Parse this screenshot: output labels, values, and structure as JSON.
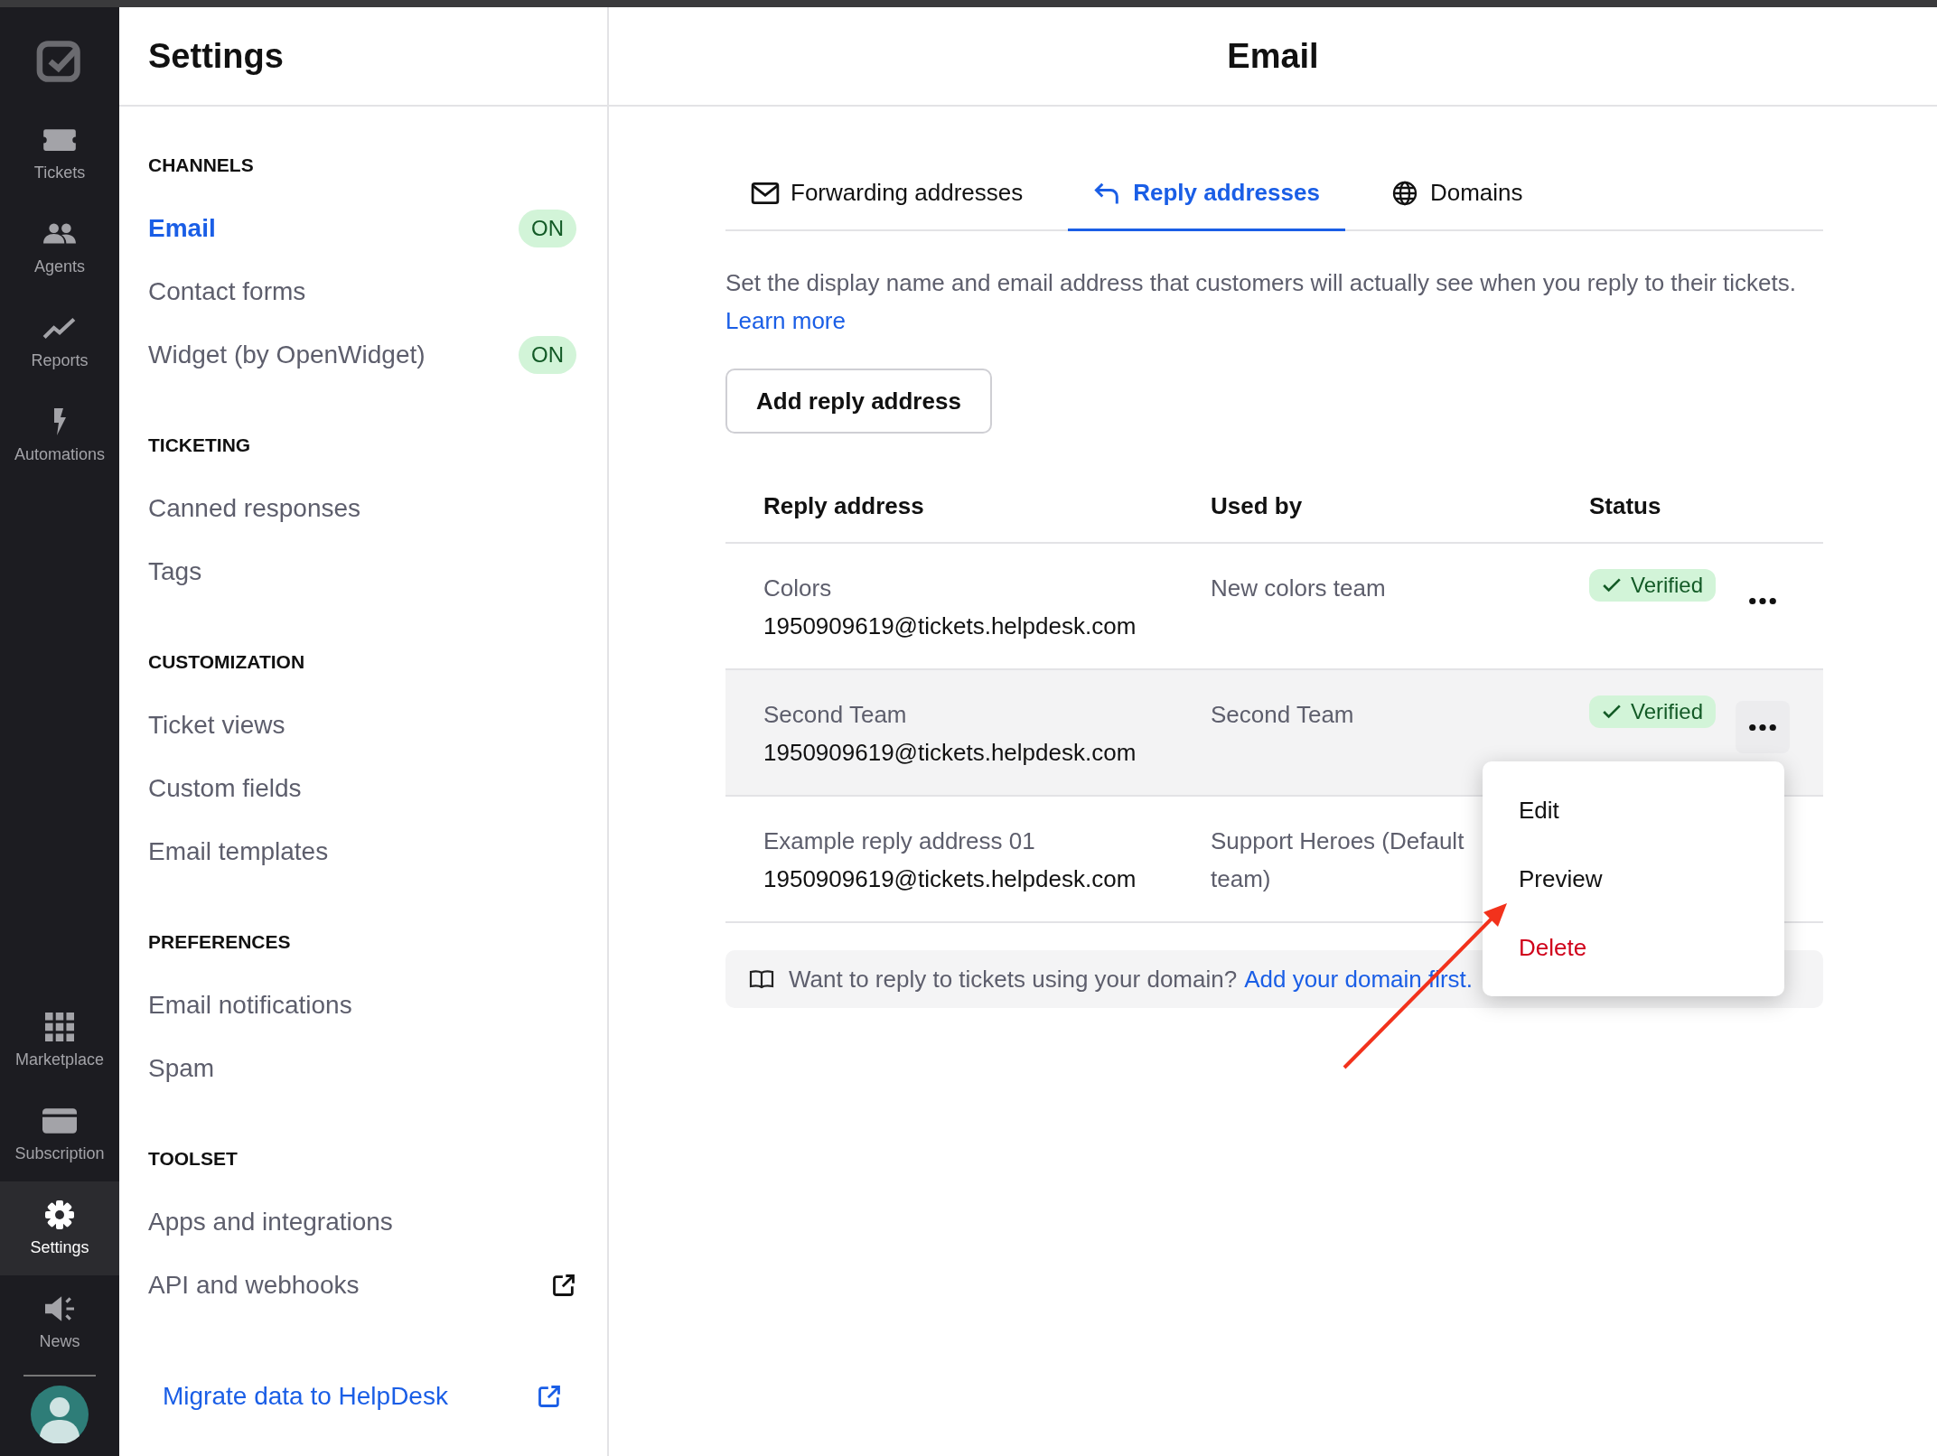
{
  "rail": {
    "top": [
      {
        "label": "Tickets",
        "selected": false
      },
      {
        "label": "Agents",
        "selected": false
      },
      {
        "label": "Reports",
        "selected": false
      },
      {
        "label": "Automations",
        "selected": false
      }
    ],
    "bottom": [
      {
        "label": "Marketplace",
        "selected": false
      },
      {
        "label": "Subscription",
        "selected": false
      },
      {
        "label": "Settings",
        "selected": true
      },
      {
        "label": "News",
        "selected": false
      }
    ]
  },
  "sidebar": {
    "title": "Settings",
    "sections": [
      {
        "heading": "CHANNELS",
        "items": [
          {
            "label": "Email",
            "selected": true,
            "badge": "ON"
          },
          {
            "label": "Contact forms",
            "selected": false
          },
          {
            "label": "Widget (by OpenWidget)",
            "selected": false,
            "badge": "ON"
          }
        ]
      },
      {
        "heading": "TICKETING",
        "items": [
          {
            "label": "Canned responses",
            "selected": false
          },
          {
            "label": "Tags",
            "selected": false
          }
        ]
      },
      {
        "heading": "CUSTOMIZATION",
        "items": [
          {
            "label": "Ticket views",
            "selected": false
          },
          {
            "label": "Custom fields",
            "selected": false
          },
          {
            "label": "Email templates",
            "selected": false
          }
        ]
      },
      {
        "heading": "PREFERENCES",
        "items": [
          {
            "label": "Email notifications",
            "selected": false
          },
          {
            "label": "Spam",
            "selected": false
          }
        ]
      },
      {
        "heading": "TOOLSET",
        "items": [
          {
            "label": "Apps and integrations",
            "selected": false
          },
          {
            "label": "API and webhooks",
            "selected": false,
            "external": true
          }
        ]
      }
    ],
    "migrate_link": "Migrate data to HelpDesk"
  },
  "main": {
    "title": "Email",
    "tabs": [
      {
        "label": "Forwarding addresses",
        "selected": false
      },
      {
        "label": "Reply addresses",
        "selected": true
      },
      {
        "label": "Domains",
        "selected": false
      }
    ],
    "description": "Set the display name and email address that customers will actually see when you reply to their tickets.",
    "learn_more": "Learn more",
    "add_button": "Add reply address",
    "table": {
      "columns": [
        "Reply address",
        "Used by",
        "Status"
      ],
      "rows": [
        {
          "name": "Colors",
          "email": "1950909619@tickets.helpdesk.com",
          "used_by": "New colors team",
          "status": "Verified",
          "hovered": false
        },
        {
          "name": "Second Team",
          "email": "1950909619@tickets.helpdesk.com",
          "used_by": "Second Team",
          "status": "Verified",
          "hovered": true
        },
        {
          "name": "Example reply address 01",
          "email": "1950909619@tickets.helpdesk.com",
          "used_by": "Support Heroes (Default team)",
          "hovered": false
        }
      ]
    },
    "menu": [
      {
        "label": "Edit",
        "kind": "normal"
      },
      {
        "label": "Preview",
        "kind": "normal"
      },
      {
        "label": "Delete",
        "kind": "danger"
      }
    ],
    "banner": {
      "text": "Want to reply to tickets using your domain?",
      "link": "Add your domain first."
    }
  }
}
